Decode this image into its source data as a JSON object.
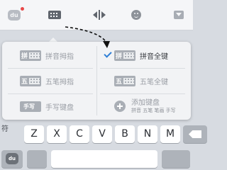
{
  "toolbar": {
    "logo_icon": "sogou-bear-logo-icon",
    "logo_text": "du",
    "notification_dot_color": "#e84848",
    "buttons": [
      {
        "icon": "keyboard-switch-icon"
      },
      {
        "icon": "cursor-move-icon"
      },
      {
        "icon": "emoji-icon"
      },
      {
        "icon": "collapse-keyboard-icon"
      }
    ]
  },
  "popup": {
    "options": [
      {
        "key_char": "拼",
        "label": "拼音拇指",
        "selected": false
      },
      {
        "key_char": "拼",
        "label": "拼音全键",
        "selected": true
      },
      {
        "key_char": "五",
        "label": "五笔拇指",
        "selected": false
      },
      {
        "key_char": "五",
        "label": "五笔全键",
        "selected": false
      },
      {
        "key_char": "手写",
        "label": "手写键盘",
        "selected": false
      }
    ],
    "add": {
      "label": "添加键盘",
      "sublabel": "拼音 五笔 笔画 手写"
    },
    "check_color": "#2f7fd6"
  },
  "keyboard": {
    "symbol_label": "符",
    "row": [
      "Z",
      "X",
      "C",
      "V",
      "B",
      "N",
      "M"
    ],
    "bottom_logo_text": "du"
  }
}
